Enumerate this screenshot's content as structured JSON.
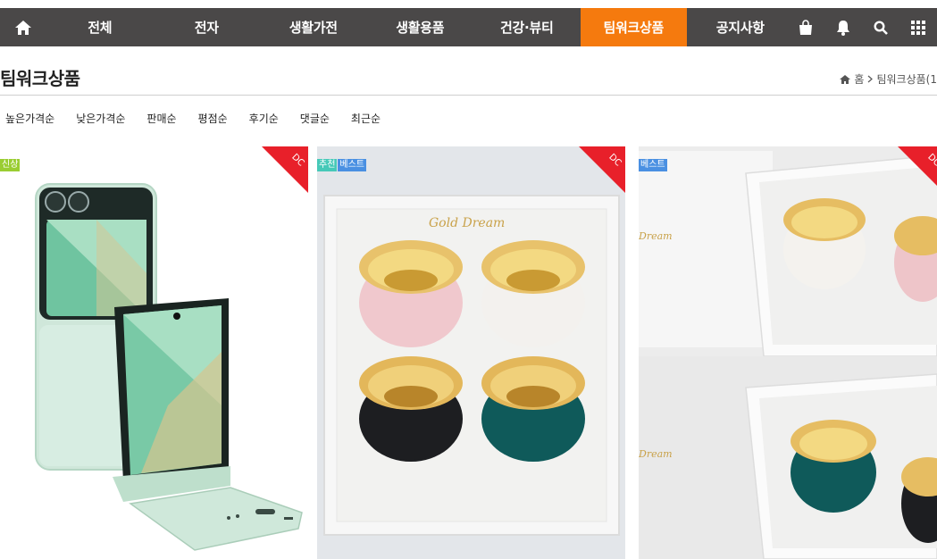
{
  "nav": {
    "items": [
      {
        "label": "전체"
      },
      {
        "label": "전자"
      },
      {
        "label": "생활가전"
      },
      {
        "label": "생활용품"
      },
      {
        "label": "건강·뷰티"
      },
      {
        "label": "팀워크상품"
      },
      {
        "label": "공지사항"
      }
    ],
    "active_color": "#f57a0e",
    "bar_color": "#4a4848"
  },
  "page": {
    "title": "팀워크상품",
    "breadcrumb": {
      "home": "홈",
      "current": "팀워크상품(1"
    }
  },
  "sort": [
    "높은가격순",
    "낮은가격순",
    "판매순",
    "평점순",
    "후기순",
    "댓글순",
    "최근순"
  ],
  "products": [
    {
      "badges": [
        {
          "label": "신상",
          "color": "#9acd32"
        }
      ],
      "discount": "DC"
    },
    {
      "badges": [
        {
          "label": "추천",
          "color": "#46c9b8"
        },
        {
          "label": "베스트",
          "color": "#4a90e2"
        }
      ],
      "discount": "DC"
    },
    {
      "badges": [
        {
          "label": "베스트",
          "color": "#4a90e2"
        }
      ],
      "discount": "DC"
    }
  ],
  "ribbon_color": "#e8202a",
  "images": {
    "bowl_brand": "Gold Dream",
    "bowl_brand_partial": "Dream"
  }
}
